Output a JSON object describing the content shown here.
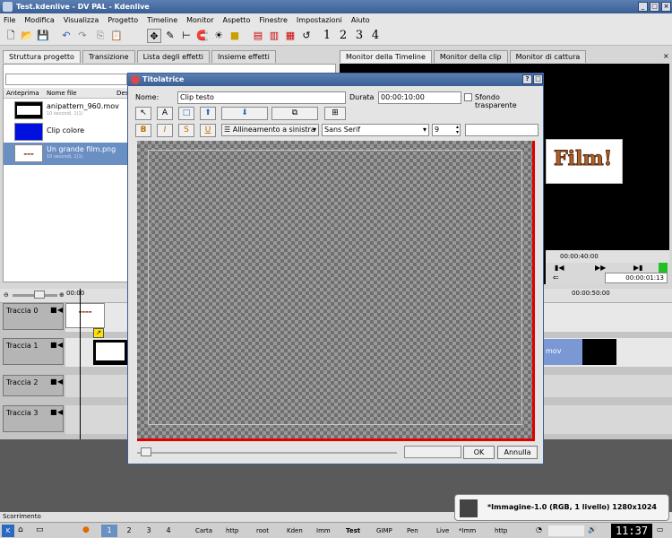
{
  "window": {
    "title": "Test.kdenlive - DV PAL - Kdenlive"
  },
  "menu": [
    "File",
    "Modifica",
    "Visualizza",
    "Progetto",
    "Timeline",
    "Monitor",
    "Aspetto",
    "Finestre",
    "Impostazioni",
    "Aiuto"
  ],
  "toolbar": {
    "numbers": [
      "1",
      "2",
      "3",
      "4"
    ]
  },
  "left_tabs": [
    "Struttura progetto",
    "Transizione",
    "Lista degli effetti",
    "Insieme effetti"
  ],
  "right_tabs": [
    "Monitor della Timeline",
    "Monitor della clip",
    "Monitor di cattura"
  ],
  "project": {
    "columns": [
      "Anteprima",
      "Nome file",
      "Des"
    ],
    "items": [
      {
        "name": "anipattern_960.mov",
        "sub": "10 secondi, 1(1)"
      },
      {
        "name": "Clip colore",
        "sub": ""
      },
      {
        "name": "Un grande film.png",
        "sub": "10 secondi, 1(1)"
      }
    ]
  },
  "monitor": {
    "preview_text": "Film!",
    "timecode_ruler": "00:00:40:00",
    "timecode": "00:00:01:13"
  },
  "timeline": {
    "ruler": [
      "00:00",
      "00:00:50:00"
    ],
    "tracks": [
      "Traccia 0",
      "Traccia 1",
      "Traccia 2",
      "Traccia 3"
    ],
    "clip_label": "mov"
  },
  "dialog": {
    "title": "Titolatrice",
    "name_label": "Nome:",
    "name_value": "Clip testo",
    "duration_label": "Durata",
    "duration_value": "00:00:10:00",
    "transparent_label": "Sfondo trasparente",
    "align_label": "Allineamento a sinistra",
    "font_value": "Sans Serif",
    "font_size": "9",
    "ok_label": "OK",
    "cancel_label": "Annulla"
  },
  "status": {
    "text": "Scorrimento"
  },
  "notification": {
    "text": "*Immagine-1.0 (RGB, 1 livello) 1280x1024"
  },
  "taskbar": {
    "desktops": [
      "1",
      "2",
      "3",
      "4"
    ],
    "tasks": [
      "Carta",
      "http",
      "root",
      "Kden",
      "Imm",
      "Test",
      "GIMP",
      "Pen",
      "Live",
      "*Imm",
      "http"
    ],
    "clock": "11:37"
  }
}
